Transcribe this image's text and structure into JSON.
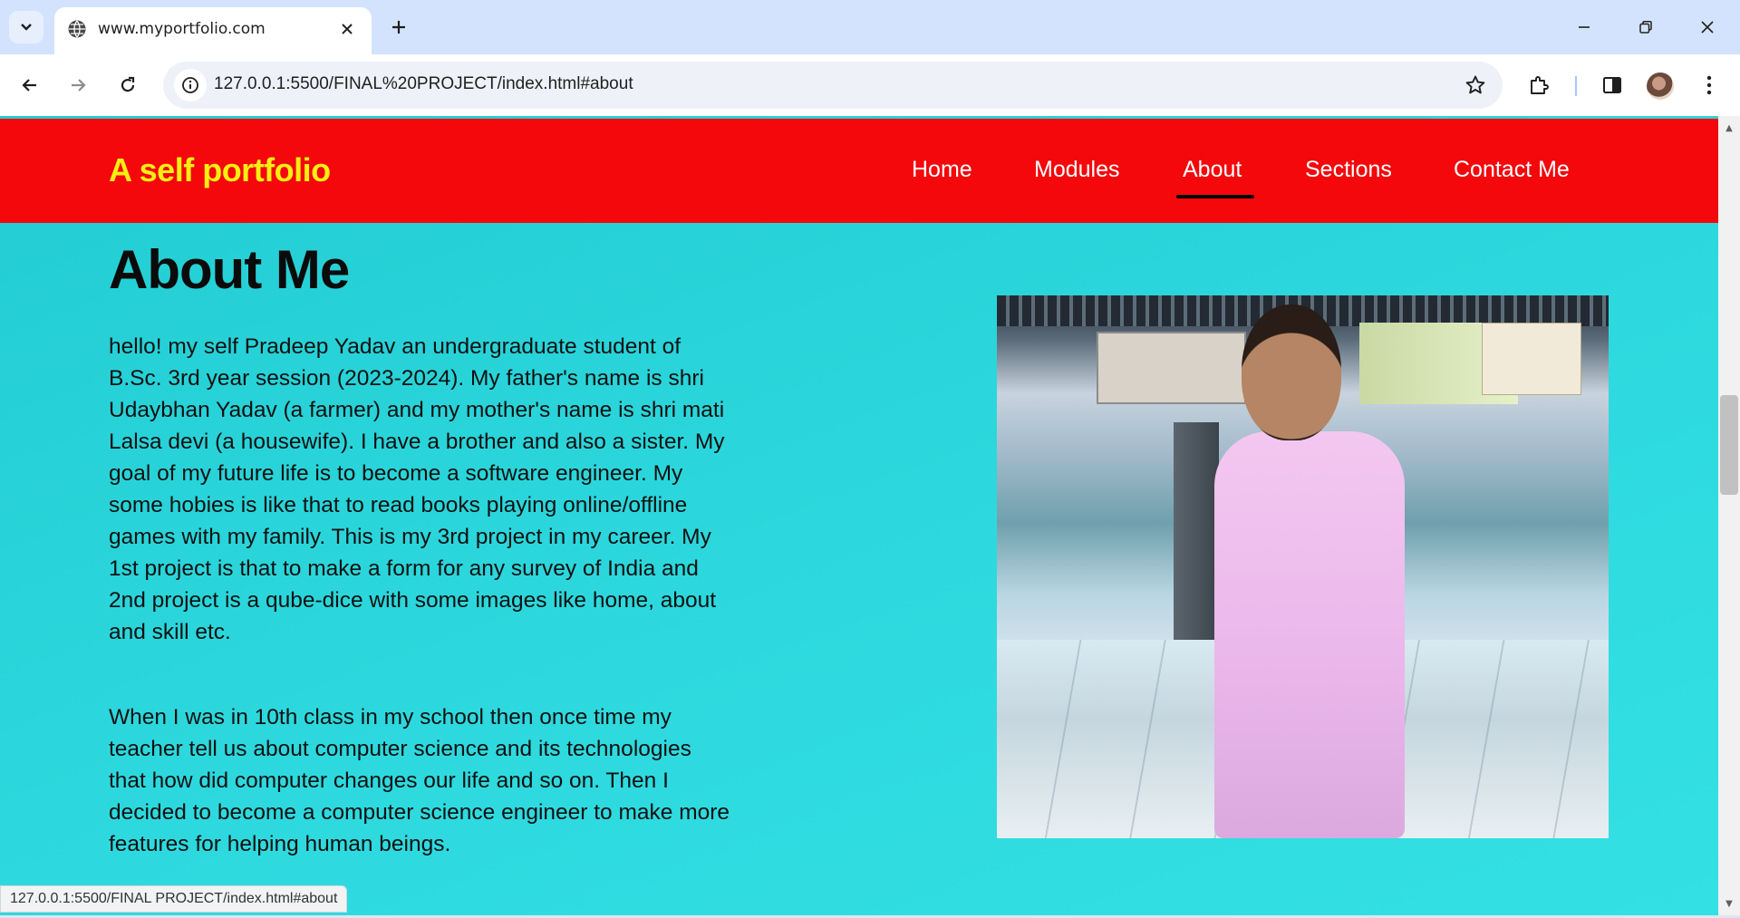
{
  "browser": {
    "tab_title": "www.myportfolio.com",
    "url": "127.0.0.1:5500/FINAL%20PROJECT/index.html#about",
    "status_url": "127.0.0.1:5500/FINAL PROJECT/index.html#about",
    "icons": [
      "tab-search-icon",
      "globe-icon",
      "close-icon",
      "plus-icon",
      "minimize-icon",
      "restore-icon",
      "window-close-icon",
      "back-icon",
      "forward-icon",
      "reload-icon",
      "site-info-icon",
      "bookmark-star-icon",
      "extensions-icon",
      "side-panel-icon",
      "profile-avatar",
      "more-menu-icon"
    ]
  },
  "site": {
    "brand": "A self portfolio",
    "nav": [
      {
        "label": "Home",
        "active": false
      },
      {
        "label": "Modules",
        "active": false
      },
      {
        "label": "About",
        "active": true
      },
      {
        "label": "Sections",
        "active": false
      },
      {
        "label": "Contact Me",
        "active": false
      }
    ],
    "colors": {
      "header": "#f4080b",
      "brand": "#f6ee14",
      "background": "#2dd9de"
    }
  },
  "about": {
    "title": "About Me",
    "paragraph1": "hello! my self Pradeep Yadav an undergraduate student of B.Sc. 3rd year session (2023-2024). My father's name is shri Udaybhan Yadav (a farmer) and my mother's name is shri mati Lalsa devi (a housewife). I have a brother and also a sister. My goal of my future life is to become a software engineer. My some hobies is like that to read books playing online/offline games with my family. This is my 3rd project in my career. My 1st project is that to make a form for any survey of India and 2nd project is a qube-dice with some images like home, about and skill etc.",
    "paragraph2": "When I was in 10th class in my school then once time my teacher tell us about computer science and its technologies that how did computer changes our life and so on. Then I decided to become a computer science engineer to make more features for helping human beings."
  }
}
